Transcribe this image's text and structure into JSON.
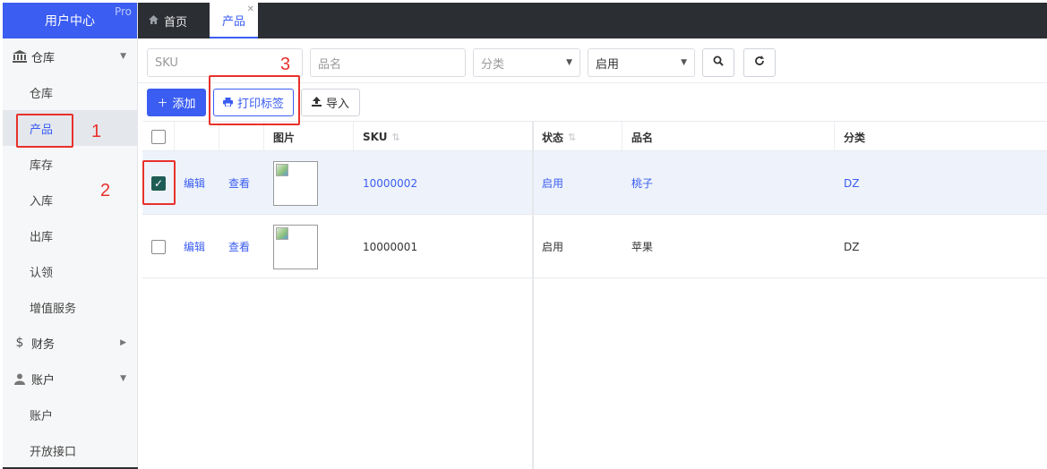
{
  "sidebar": {
    "brand": "用户中心",
    "pro": "Pro",
    "groups": [
      {
        "label": "仓库",
        "icon": "bank-icon",
        "expanded": true,
        "items": [
          "仓库",
          "产品",
          "库存",
          "入库",
          "出库",
          "认领",
          "增值服务"
        ]
      },
      {
        "label": "财务",
        "icon": "dollar-icon",
        "expanded": false,
        "items": []
      },
      {
        "label": "账户",
        "icon": "user-icon",
        "expanded": true,
        "items": [
          "账户",
          "开放接口"
        ]
      }
    ],
    "active_item": "产品"
  },
  "tabs": {
    "home": "首页",
    "active": "产品"
  },
  "filters": {
    "sku_placeholder": "SKU",
    "name_placeholder": "品名",
    "category_value": "分类",
    "status_value": "启用"
  },
  "actions": {
    "add": "添加",
    "print_label": "打印标签",
    "import": "导入"
  },
  "table": {
    "columns": {
      "image": "图片",
      "sku": "SKU",
      "status": "状态",
      "name": "品名",
      "category": "分类"
    },
    "rows": [
      {
        "selected": true,
        "edit": "编辑",
        "view": "查看",
        "sku": "10000002",
        "status": "启用",
        "name": "桃子",
        "category": "DZ"
      },
      {
        "selected": false,
        "edit": "编辑",
        "view": "查看",
        "sku": "10000001",
        "status": "启用",
        "name": "苹果",
        "category": "DZ"
      }
    ]
  },
  "annotations": {
    "n1": "1",
    "n2": "2",
    "n3": "3"
  },
  "colors": {
    "primary": "#3b5df1",
    "annotation": "#e8312b",
    "topbar": "#2b2e33",
    "checkbox": "#1f5c55"
  }
}
